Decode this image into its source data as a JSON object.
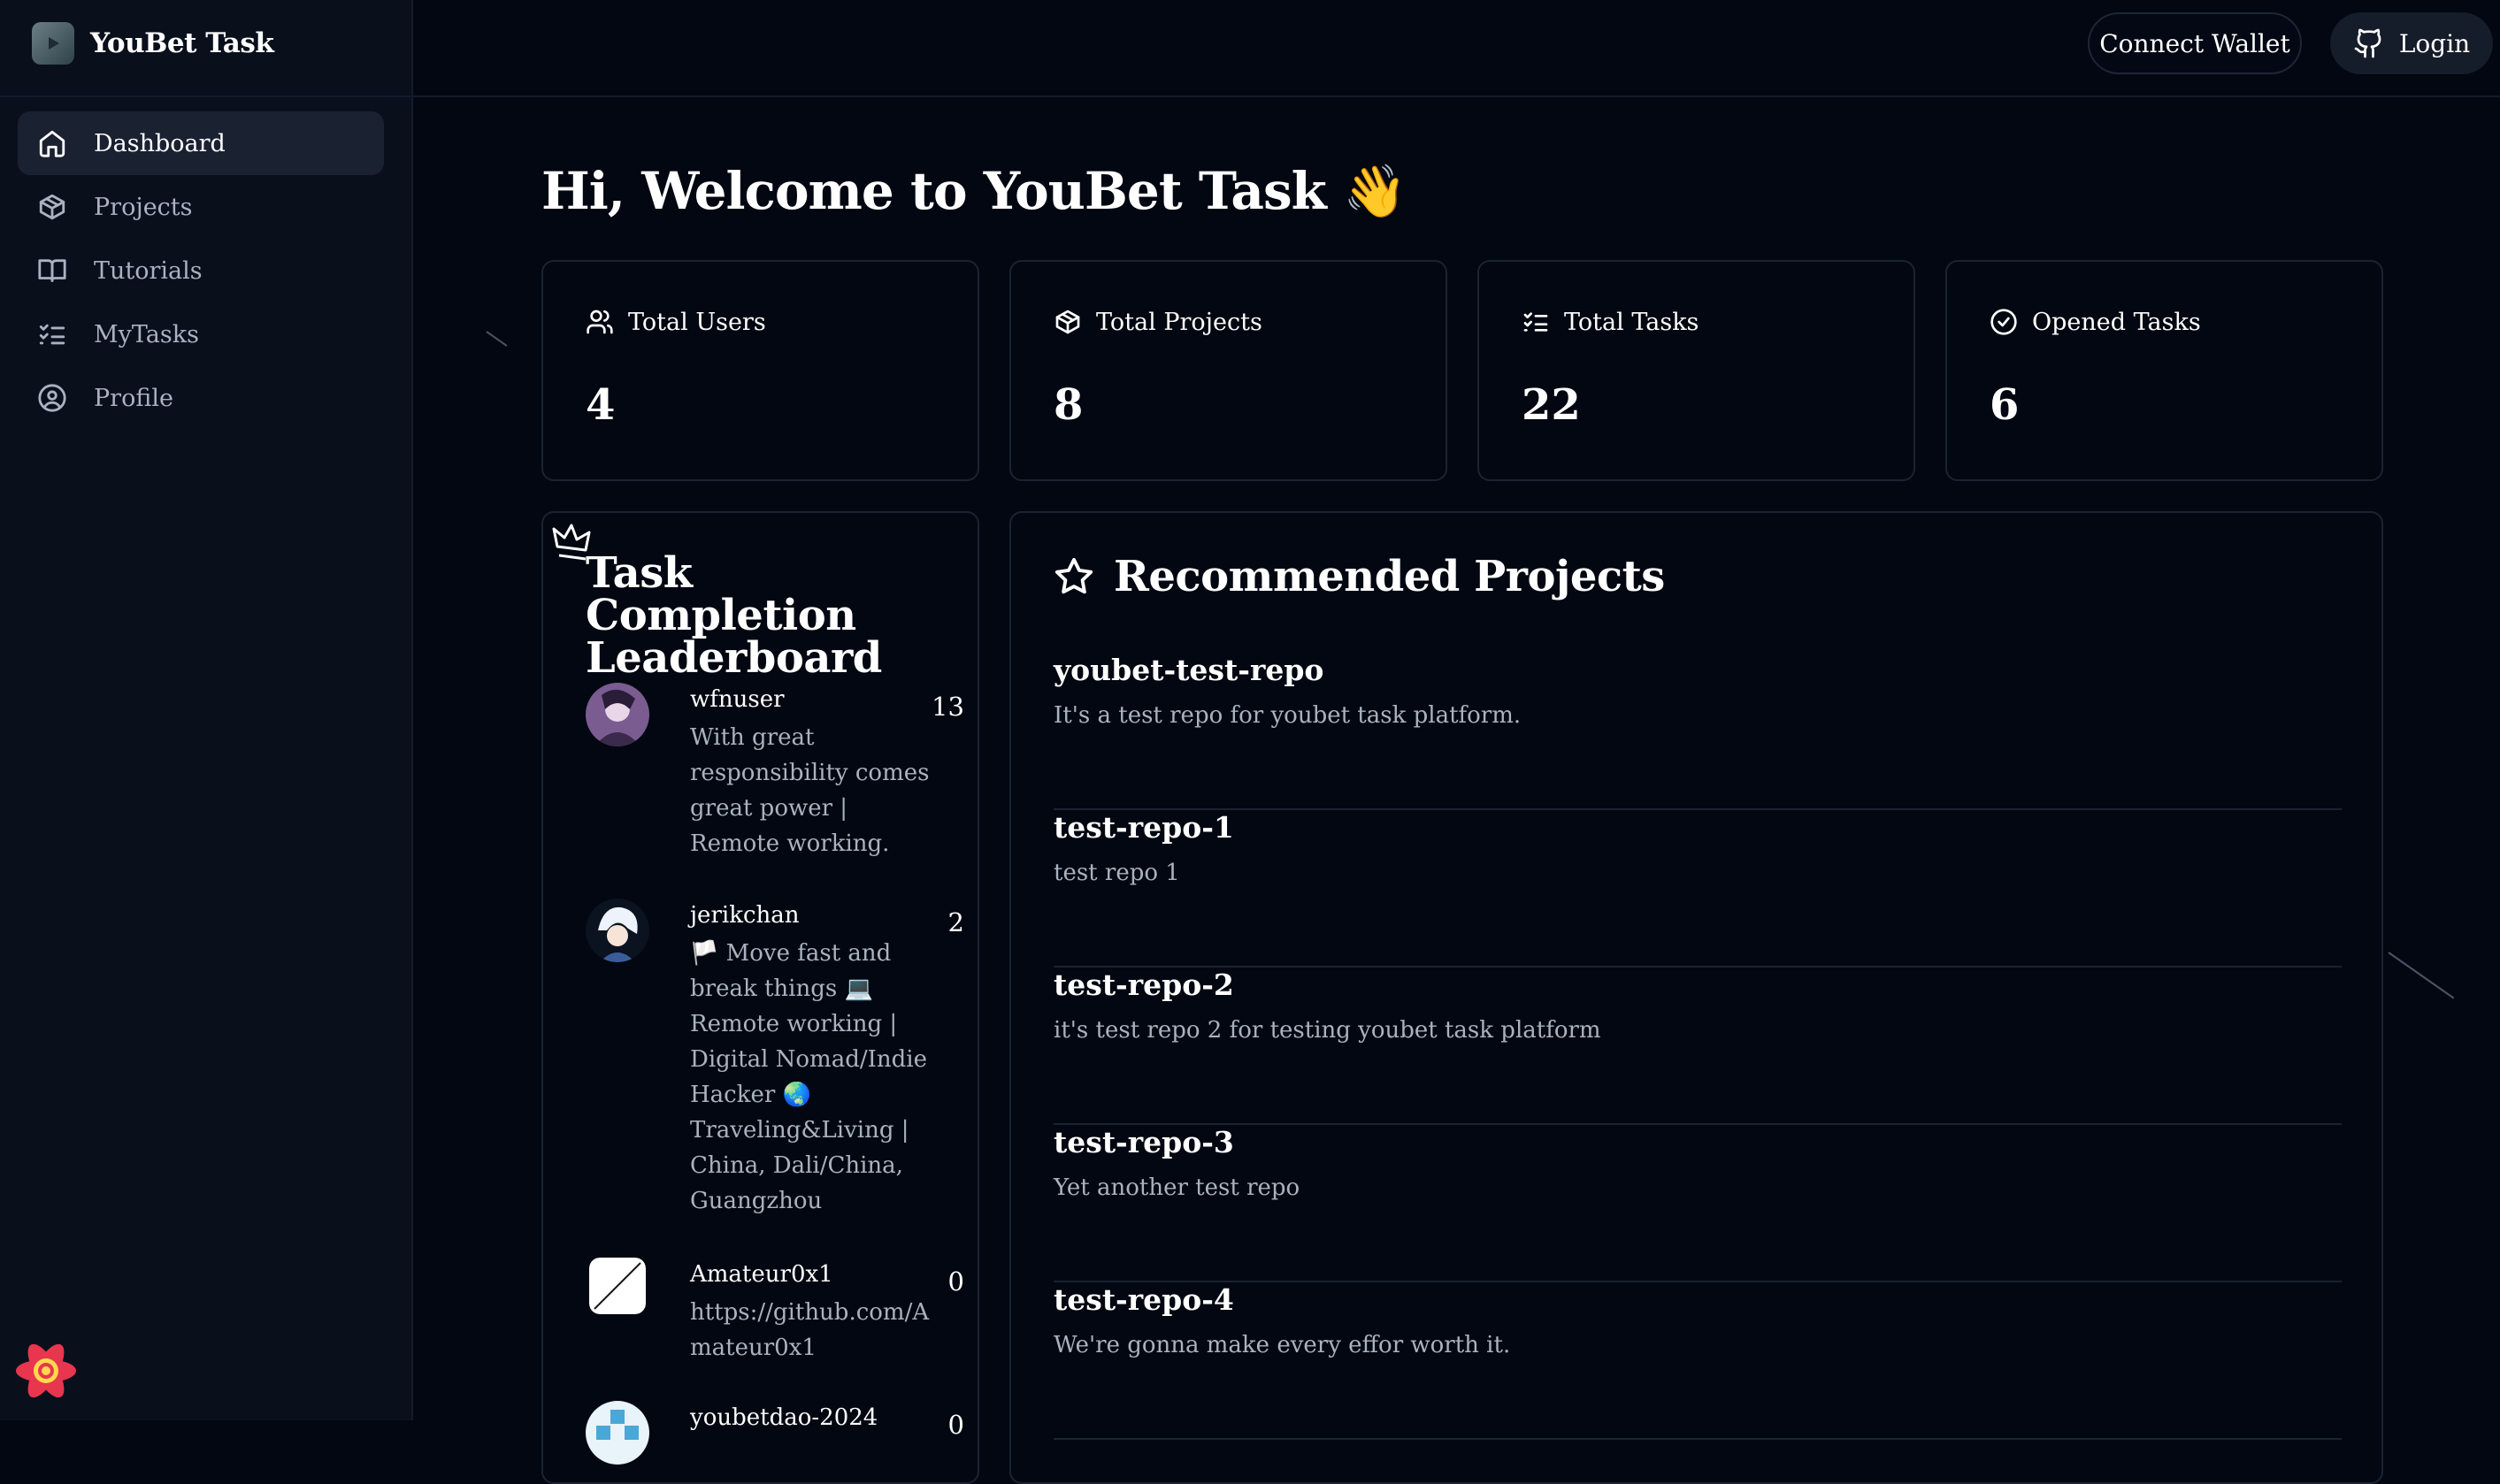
{
  "app": {
    "name": "YouBet Task"
  },
  "sidebar": {
    "items": [
      {
        "label": "Dashboard",
        "icon": "home-icon",
        "active": true
      },
      {
        "label": "Projects",
        "icon": "package-icon",
        "active": false
      },
      {
        "label": "Tutorials",
        "icon": "book-icon",
        "active": false
      },
      {
        "label": "MyTasks",
        "icon": "list-checks-icon",
        "active": false
      },
      {
        "label": "Profile",
        "icon": "user-circle-icon",
        "active": false
      }
    ]
  },
  "header": {
    "connect_wallet_label": "Connect Wallet",
    "login_label": "Login"
  },
  "main": {
    "welcome": "Hi, Welcome to YouBet Task 👋",
    "stats": [
      {
        "label": "Total Users",
        "value": "4",
        "icon": "users-icon"
      },
      {
        "label": "Total Projects",
        "value": "8",
        "icon": "package-icon"
      },
      {
        "label": "Total Tasks",
        "value": "22",
        "icon": "list-checks-icon"
      },
      {
        "label": "Opened Tasks",
        "value": "6",
        "icon": "check-circle-icon"
      }
    ],
    "leaderboard": {
      "title": "Task Completion Leaderboard",
      "users": [
        {
          "name": "wfnuser",
          "bio": "With great responsibility comes great power | Remote working.",
          "count": "13"
        },
        {
          "name": "jerikchan",
          "bio": "🏳️ Move fast and break things 💻 Remote working | Digital Nomad/Indie Hacker 🌏 Traveling&Living | China, Dali/China, Guangzhou",
          "count": "2"
        },
        {
          "name": "Amateur0x1",
          "bio": "https://github.com/Amateur0x1",
          "count": "0"
        },
        {
          "name": "youbetdao-2024",
          "bio": "",
          "count": "0"
        }
      ]
    },
    "recommended": {
      "title": "Recommended Projects",
      "projects": [
        {
          "name": "youbet-test-repo",
          "description": "It's a test repo for youbet task platform."
        },
        {
          "name": "test-repo-1",
          "description": "test repo 1"
        },
        {
          "name": "test-repo-2",
          "description": "it's test repo 2 for testing youbet task platform"
        },
        {
          "name": "test-repo-3",
          "description": "Yet another test repo"
        },
        {
          "name": "test-repo-4",
          "description": "We're gonna make every effor worth it."
        }
      ]
    }
  },
  "colors": {
    "background": "#030711",
    "sidebar": "#09101c",
    "border": "#1b2231",
    "muted_text": "#aab2c0"
  }
}
